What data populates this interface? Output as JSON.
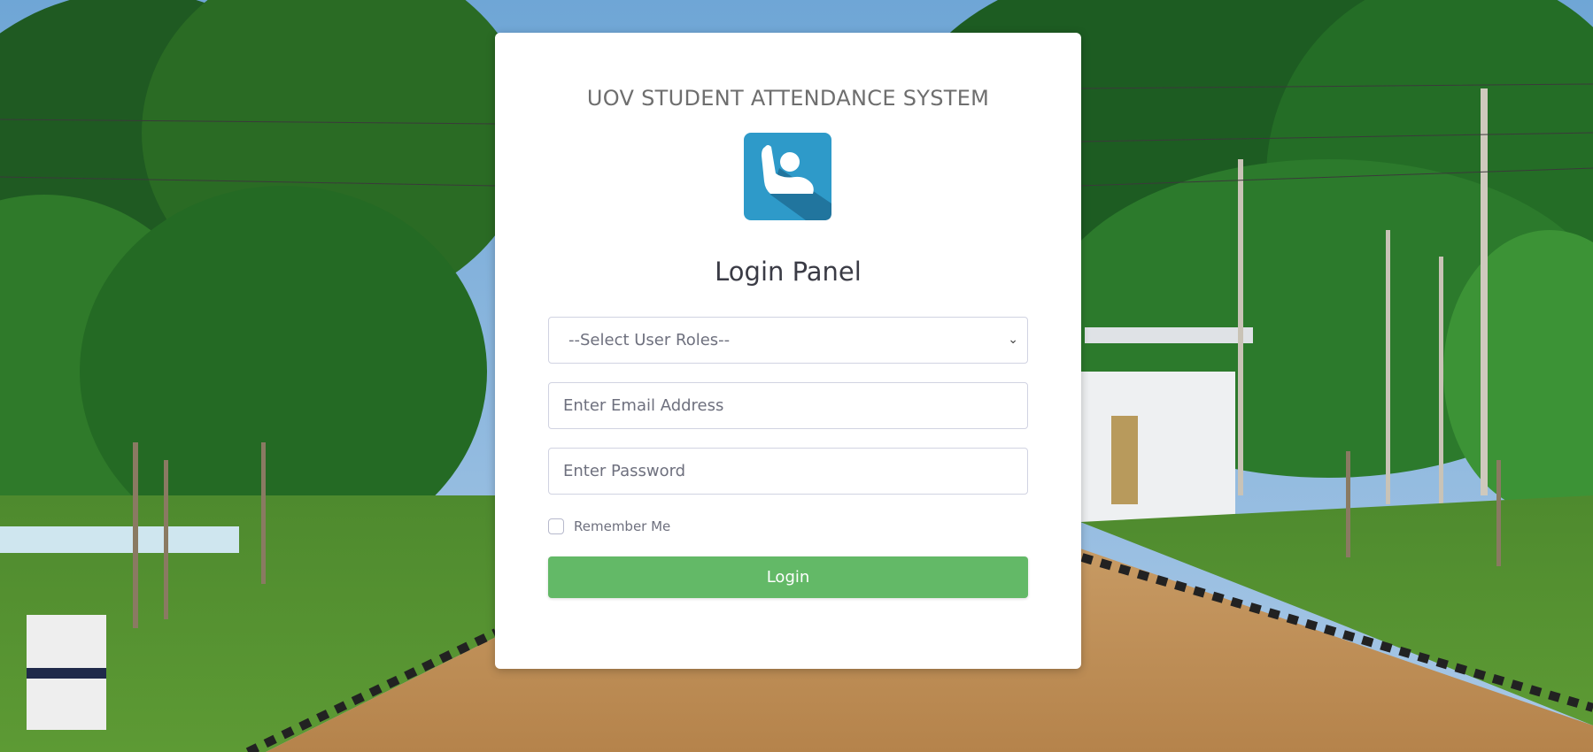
{
  "header": {
    "system_title": "UOV STUDENT ATTENDANCE SYSTEM",
    "panel_title": "Login Panel"
  },
  "form": {
    "role_select": {
      "selected": "--Select User Roles--"
    },
    "email": {
      "value": "",
      "placeholder": "Enter Email Address"
    },
    "password": {
      "value": "",
      "placeholder": "Enter Password"
    },
    "remember_me": {
      "label": "Remember Me",
      "checked": false
    },
    "submit_label": "Login"
  },
  "icons": {
    "logo": "raised-hand-student-icon",
    "select_arrow": "chevron-down-icon"
  },
  "colors": {
    "login_button": "#63b967",
    "logo_bg": "#2e9ac9",
    "card_bg": "#ffffff"
  }
}
